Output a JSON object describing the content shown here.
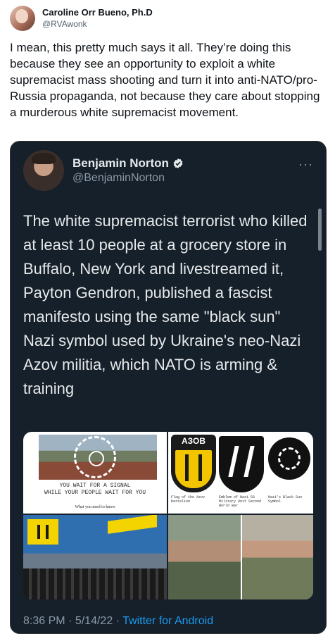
{
  "outer_tweet": {
    "author_name": "Caroline Orr Bueno, Ph.D",
    "author_handle": "@RVAwonk",
    "text": "I mean, this pretty much says it all. They’re doing this because they see an opportunity to exploit a white supremacist mass shooting and turn it into anti-NATO/pro-Russia propaganda, not because they care about stopping a murderous white supremacist movement."
  },
  "quoted_tweet": {
    "author_name": "Benjamin Norton",
    "author_handle": "@BenjaminNorton",
    "verified_icon": "verified-badge-icon",
    "more_icon": "more-horizontal-icon",
    "more_label": "···",
    "text": "The white supremacist terrorist who killed at least 10 people at a grocery store in Buffalo, New York and livestreamed it, Payton Gendron, published a fascist manifesto using the same \"black sun\" Nazi symbol used by Ukraine's neo-Nazi Azov militia, which NATO is arming & training",
    "media": {
      "image1_caption_line1": "YOU WAIT FOR A SIGNAL",
      "image1_caption_line2": "WHILE YOUR PEOPLE WAIT FOR YOU",
      "image1_caption_line3": "What you need to know",
      "image2_badge_text": "АЗОВ",
      "image2_caption_left": "Flag of the Azov battalion",
      "image2_caption_mid": "Emblem of Nazi SS Military Unit Second World War",
      "image2_caption_right": "Nazi's Black Sun Symbol"
    },
    "time": "8:36 PM",
    "separator": "·",
    "date": "5/14/22",
    "source": "Twitter for Android"
  },
  "colors": {
    "embed_bg": "#15202b",
    "embed_text": "#e7e9ea",
    "muted": "#8b98a5",
    "link": "#1d9bf0"
  }
}
